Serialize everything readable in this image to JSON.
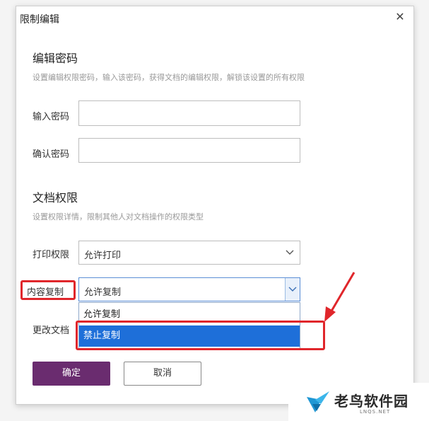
{
  "dialog": {
    "title": "限制编辑",
    "close_glyph": "✕"
  },
  "password_section": {
    "heading": "编辑密码",
    "hint": "设置编辑权限密码，输入该密码，获得文档的编辑权限，解锁该设置的所有权限",
    "enter_label": "输入密码",
    "enter_value": "",
    "confirm_label": "确认密码",
    "confirm_value": ""
  },
  "permission_section": {
    "heading": "文档权限",
    "hint": "设置权限详情，限制其他人对文档操作的权限类型",
    "print_label": "打印权限",
    "print_value": "允许打印",
    "copy_label": "内容复制",
    "copy_value": "允许复制",
    "copy_options": [
      "允许复制",
      "禁止复制"
    ],
    "copy_highlighted_option": "禁止复制",
    "modify_label": "更改文档"
  },
  "buttons": {
    "confirm": "确定",
    "cancel": "取消"
  },
  "watermark": {
    "brand": "老鸟软件园",
    "domain": "LNQS.NET"
  },
  "colors": {
    "primary_button": "#6a2c6f",
    "selected_option": "#1e6fd9",
    "annotation_red": "#e0262b"
  },
  "icons": {
    "close": "close-icon",
    "chevron": "chevron-down-icon",
    "arrow": "red-arrow-annotation",
    "logo": "bird-logo"
  }
}
